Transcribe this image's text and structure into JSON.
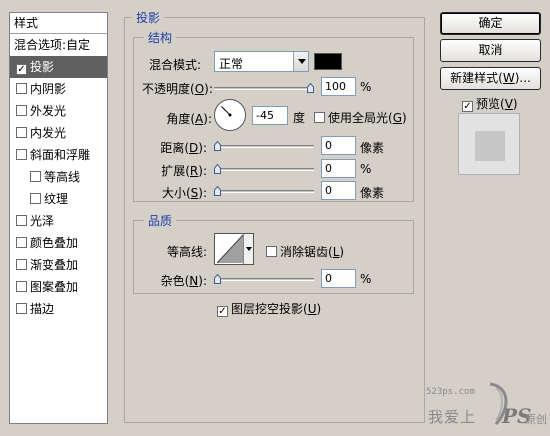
{
  "style_list": {
    "header": "样式",
    "items": [
      {
        "label": "混合选项:自定",
        "checkbox": false,
        "checked": false,
        "indent": false,
        "active": false
      },
      {
        "label": "投影",
        "checkbox": true,
        "checked": true,
        "indent": false,
        "active": true
      },
      {
        "label": "内阴影",
        "checkbox": true,
        "checked": false,
        "indent": false,
        "active": false
      },
      {
        "label": "外发光",
        "checkbox": true,
        "checked": false,
        "indent": false,
        "active": false
      },
      {
        "label": "内发光",
        "checkbox": true,
        "checked": false,
        "indent": false,
        "active": false
      },
      {
        "label": "斜面和浮雕",
        "checkbox": true,
        "checked": false,
        "indent": false,
        "active": false
      },
      {
        "label": "等高线",
        "checkbox": true,
        "checked": false,
        "indent": true,
        "active": false
      },
      {
        "label": "纹理",
        "checkbox": true,
        "checked": false,
        "indent": true,
        "active": false
      },
      {
        "label": "光泽",
        "checkbox": true,
        "checked": false,
        "indent": false,
        "active": false
      },
      {
        "label": "颜色叠加",
        "checkbox": true,
        "checked": false,
        "indent": false,
        "active": false
      },
      {
        "label": "渐变叠加",
        "checkbox": true,
        "checked": false,
        "indent": false,
        "active": false
      },
      {
        "label": "图案叠加",
        "checkbox": true,
        "checked": false,
        "indent": false,
        "active": false
      },
      {
        "label": "描边",
        "checkbox": true,
        "checked": false,
        "indent": false,
        "active": false
      }
    ]
  },
  "drop_shadow": {
    "title": "投影",
    "structure": {
      "title": "结构",
      "blend_mode": {
        "label_pre": "混合模式",
        "label_post": ":",
        "value": "正常",
        "color": "#000000"
      },
      "opacity": {
        "label_pre": "不透明度(",
        "mnemonic": "O",
        "label_post": "):",
        "value": "100",
        "unit": "%",
        "level": 1.0
      },
      "angle": {
        "label_pre": "角度(",
        "mnemonic": "A",
        "label_post": "):",
        "value": "-45",
        "unit": "度",
        "degrees": -45
      },
      "global_light": {
        "label_pre": "使用全局光(",
        "mnemonic": "G",
        "label_post": ")",
        "checked": false
      },
      "distance": {
        "label_pre": "距离(",
        "mnemonic": "D",
        "label_post": "):",
        "value": "0",
        "unit": "像素",
        "level": 0
      },
      "spread": {
        "label_pre": "扩展(",
        "mnemonic": "R",
        "label_post": "):",
        "value": "0",
        "unit": "%",
        "level": 0
      },
      "size": {
        "label_pre": "大小(",
        "mnemonic": "S",
        "label_post": "):",
        "value": "0",
        "unit": "像素",
        "level": 0
      }
    },
    "quality": {
      "title": "品质",
      "contour": {
        "label": "等高线:"
      },
      "anti_alias": {
        "label_pre": "消除锯齿(",
        "mnemonic": "L",
        "label_post": ")",
        "checked": false
      },
      "noise": {
        "label_pre": "杂色(",
        "mnemonic": "N",
        "label_post": "):",
        "value": "0",
        "unit": "%",
        "level": 0
      }
    },
    "knockout": {
      "label_pre": "图层挖空投影(",
      "mnemonic": "U",
      "label_post": ")",
      "checked": true
    }
  },
  "buttons": {
    "ok": "确定",
    "cancel": "取消",
    "new_style_pre": "新建样式(",
    "new_style_mnemonic": "W",
    "new_style_post": ")...",
    "preview_pre": "预览(",
    "preview_mnemonic": "V",
    "preview_post": ")",
    "preview_checked": true
  },
  "watermark": {
    "site": "523ps.com",
    "text_pre": "我爱上",
    "text_logo": "PS",
    "text_post": "原创"
  }
}
